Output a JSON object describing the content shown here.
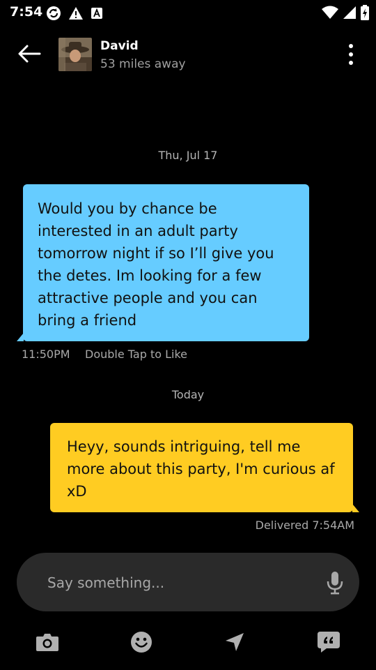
{
  "status_bar": {
    "time": "7:54"
  },
  "header": {
    "name": "David",
    "distance": "53 miles away"
  },
  "conversation": {
    "divider_1": "Thu, Jul 17",
    "incoming": {
      "text": "Would you by chance be interested in an adult party tomorrow night if so  I’ll give you the detes. Im looking for a few attractive people and you can bring a friend",
      "time": "11:50PM",
      "like_hint": "Double Tap to Like"
    },
    "divider_2": "Today",
    "outgoing": {
      "text": "Heyy, sounds intriguing, tell me more about this party, I'm curious af xD",
      "status": "Delivered 7:54AM"
    }
  },
  "composer": {
    "placeholder": "Say something..."
  },
  "colors": {
    "incoming_bubble": "#66ccff",
    "outgoing_bubble": "#ffcc22",
    "background": "#000000",
    "composer_bg": "#2a2a2a"
  },
  "icons": [
    "camera-icon",
    "emoji-icon",
    "location-icon",
    "saved-phrases-icon",
    "mic-icon",
    "back-arrow-icon",
    "more-options-icon"
  ]
}
